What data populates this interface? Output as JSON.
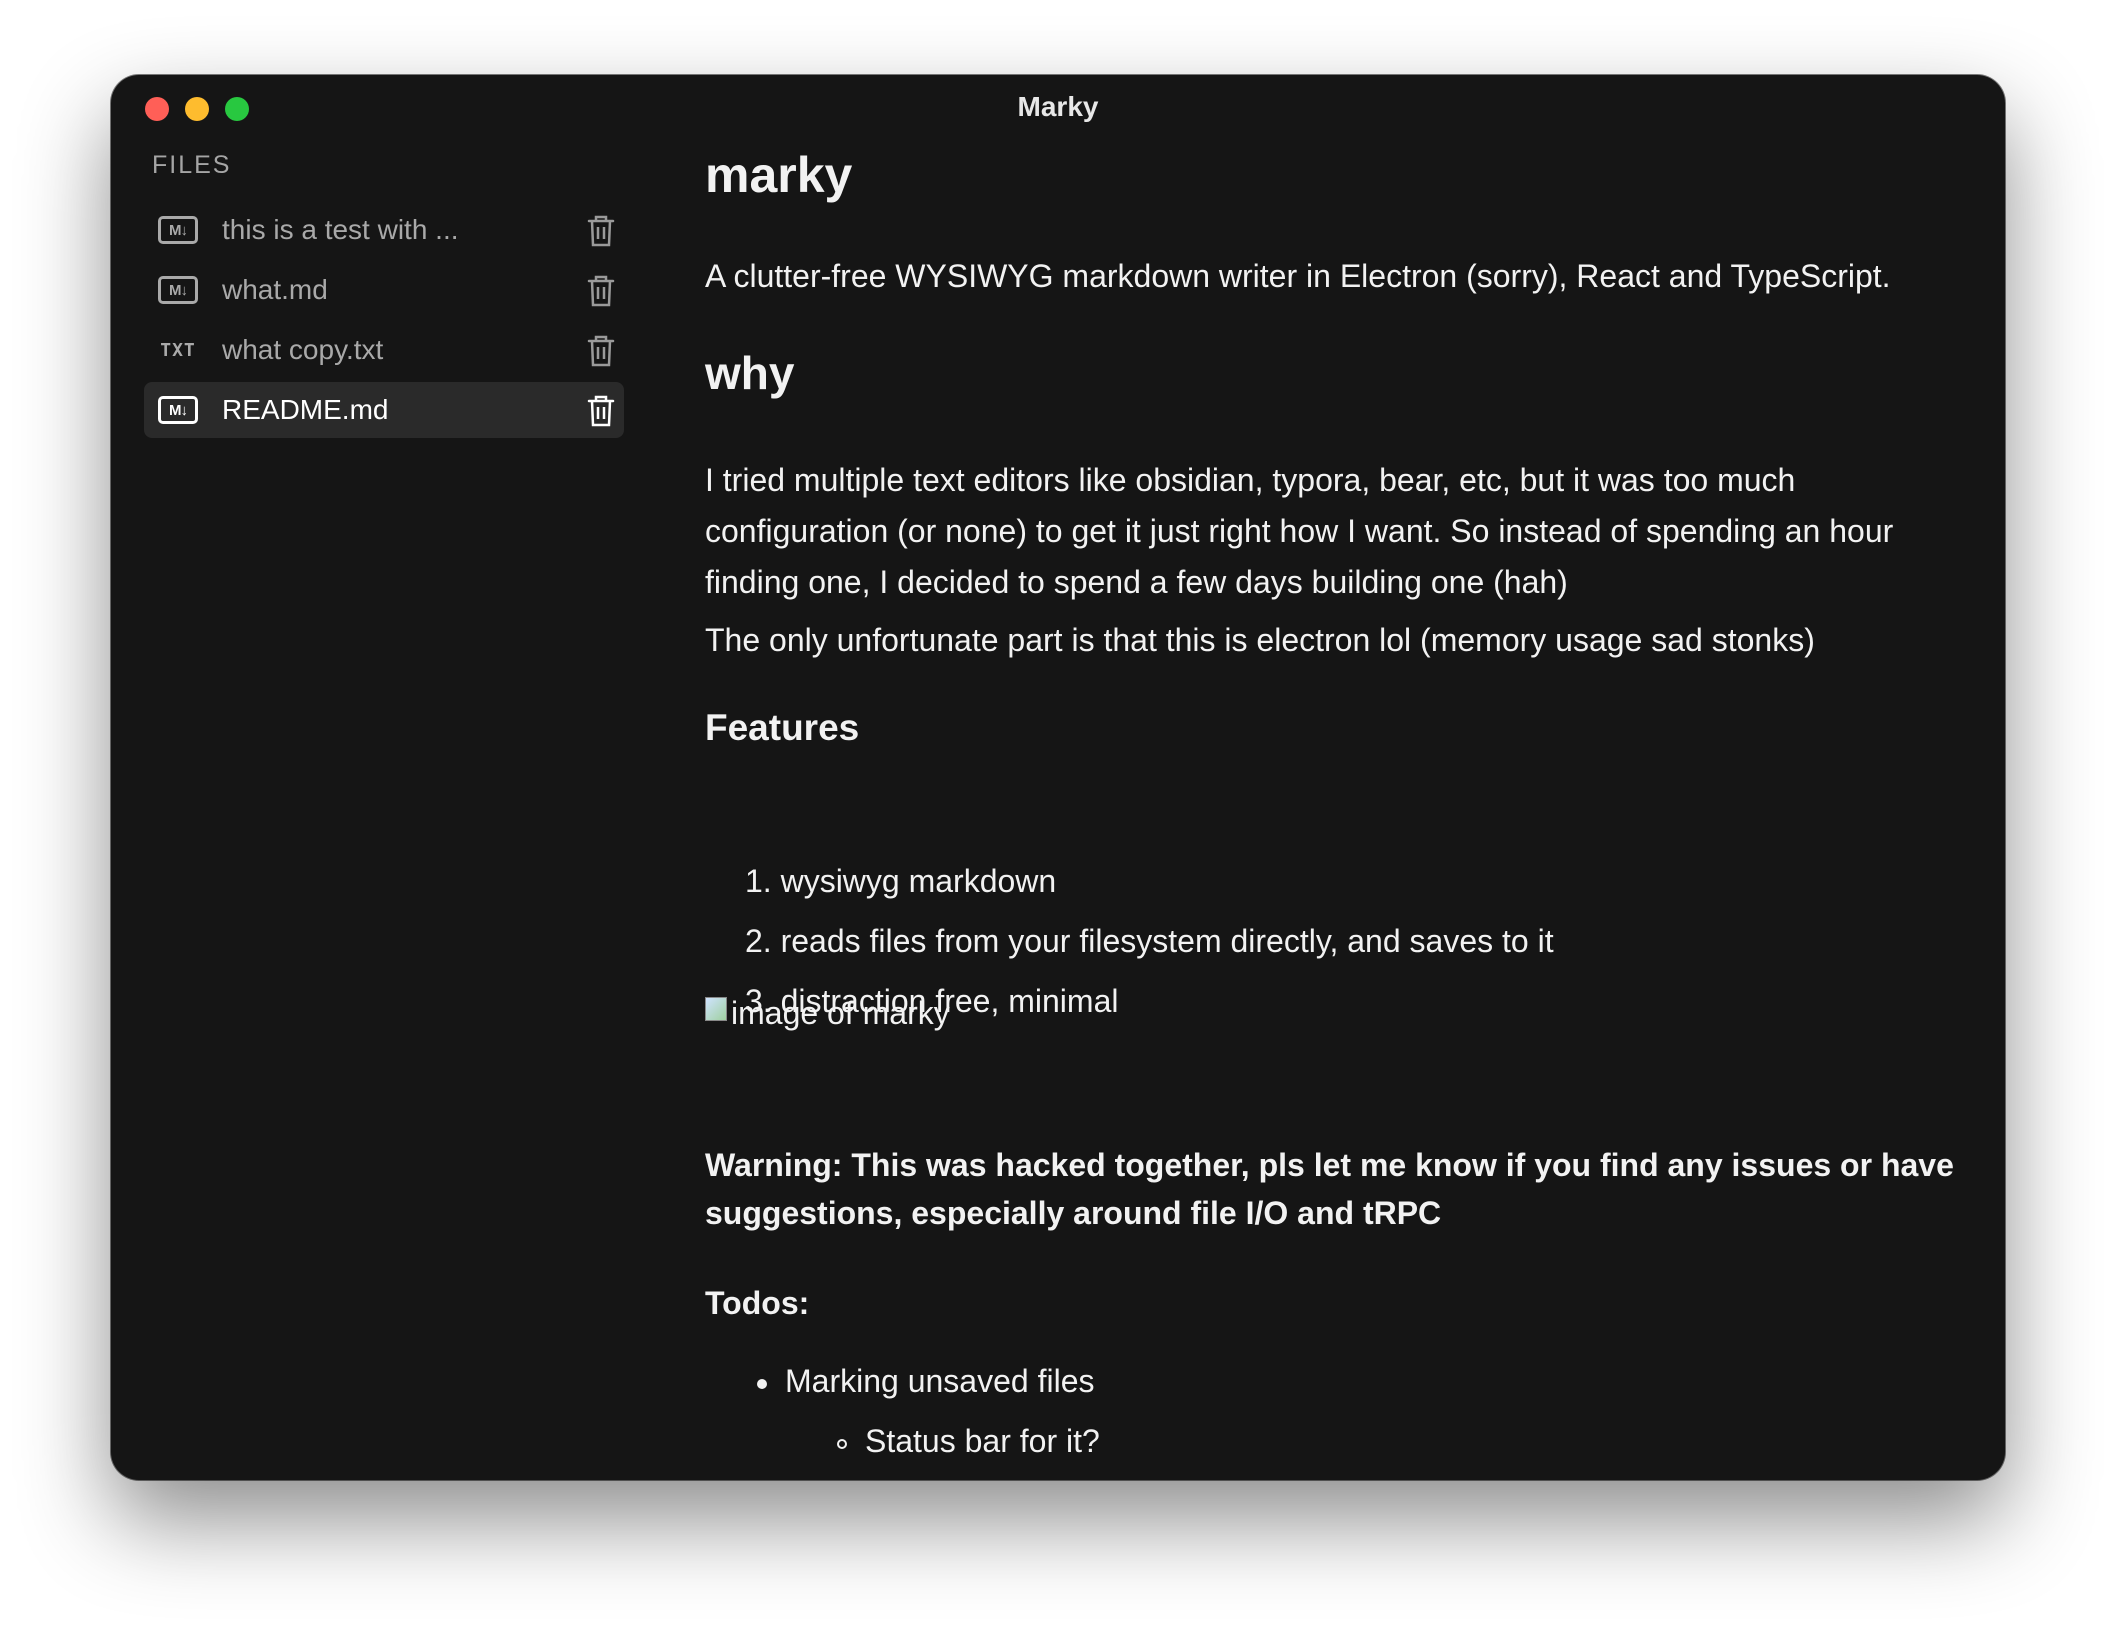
{
  "window": {
    "title": "Marky"
  },
  "sidebar": {
    "heading": "FILES",
    "files": [
      {
        "type_badge": "M↓",
        "name": "this is a test with ...",
        "icon": "markdown-file-icon",
        "active": false
      },
      {
        "type_badge": "M↓",
        "name": "what.md",
        "icon": "markdown-file-icon",
        "active": false
      },
      {
        "type_badge": "TXT",
        "name": "what copy.txt",
        "icon": "text-file-icon",
        "active": false
      },
      {
        "type_badge": "M↓",
        "name": "README.md",
        "icon": "markdown-file-icon",
        "active": true
      }
    ],
    "delete_icon": "trash-icon"
  },
  "document": {
    "title": "marky",
    "intro": "A clutter-free WYSIWYG markdown writer in Electron (sorry), React and TypeScript.",
    "why_heading": "why",
    "why_paragraph": "I tried multiple text editors like obsidian, typora, bear, etc, but it was too much configuration (or none) to get it just right how I want. So instead of spending an hour finding one, I decided to spend a few days building one (hah)",
    "why_paragraph_2": "The only unfortunate part is that this is electron lol (memory usage sad stonks)",
    "features_heading": "Features",
    "features": [
      {
        "num": "1.",
        "text": "wysiwyg markdown"
      },
      {
        "num": "2.",
        "text": "reads files from your filesystem directly, and saves to it"
      },
      {
        "num": "3.",
        "text": "distraction free, minimal"
      }
    ],
    "image_alt": "image of marky",
    "warning": "Warning: This was hacked together, pls let me know if you find any issues or have suggestions, especially around file I/O and tRPC",
    "todos_heading": "Todos:",
    "todos": [
      "Marking unsaved files"
    ],
    "todo_sub": [
      "Status bar for it?"
    ]
  },
  "colors": {
    "window_bg": "#151515",
    "active_row": "#2a2a2a",
    "traffic_close": "#ff5f57",
    "traffic_min": "#febc2e",
    "traffic_max": "#28c840"
  }
}
